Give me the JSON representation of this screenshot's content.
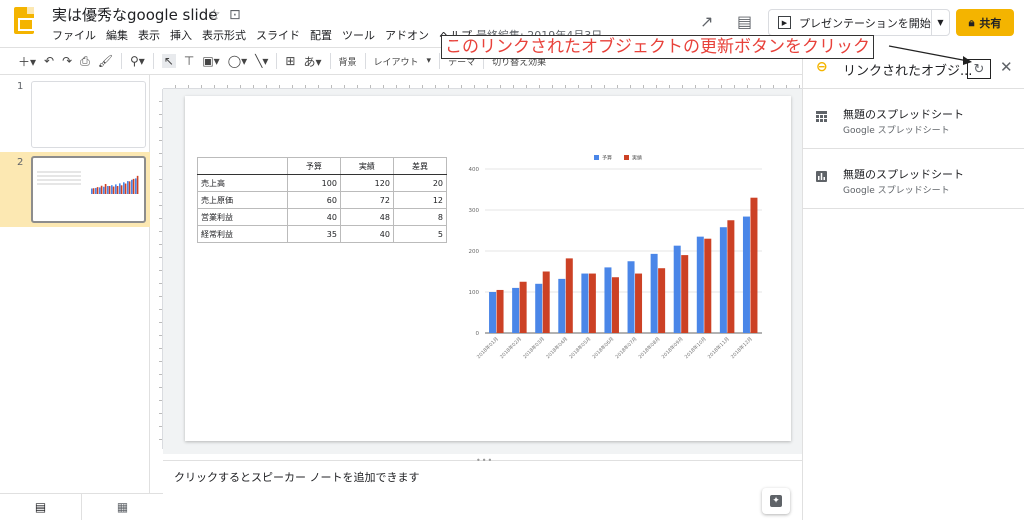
{
  "header": {
    "title": "実は優秀なgoogle slide",
    "menu": [
      "ファイル",
      "編集",
      "表示",
      "挿入",
      "表示形式",
      "スライド",
      "配置",
      "ツール",
      "アドオン",
      "ヘルプ"
    ],
    "last_edit": "最終編集: 2019年4月3日",
    "present_label": "プレゼンテーションを開始",
    "share_label": "共有"
  },
  "toolbar": {
    "background_label": "背景",
    "layout_label": "レイアウト",
    "theme_label": "テーマ",
    "transition_label": "切り替え効果"
  },
  "annotation": {
    "text": "このリンクされたオブジェクトの更新ボタンをクリック"
  },
  "filmstrip": {
    "slides": [
      "1",
      "2"
    ]
  },
  "slide": {
    "table": {
      "headers": [
        "",
        "予算",
        "実績",
        "差異"
      ],
      "rows": [
        {
          "label": "売上高",
          "budget": "100",
          "actual": "120",
          "diff": "20"
        },
        {
          "label": "売上原価",
          "budget": "60",
          "actual": "72",
          "diff": "12"
        },
        {
          "label": "営業利益",
          "budget": "40",
          "actual": "48",
          "diff": "8"
        },
        {
          "label": "経常利益",
          "budget": "35",
          "actual": "40",
          "diff": "5"
        }
      ]
    }
  },
  "chart_data": {
    "type": "bar",
    "categories": [
      "2018年01月",
      "2018年02月",
      "2018年03月",
      "2018年04月",
      "2018年05月",
      "2018年06月",
      "2018年07月",
      "2018年08月",
      "2018年09月",
      "2018年10月",
      "2018年11月",
      "2018年12月"
    ],
    "series": [
      {
        "name": "予算",
        "color": "#4a86e8",
        "values": [
          100,
          110,
          120,
          132,
          145,
          160,
          175,
          193,
          213,
          235,
          258,
          284
        ]
      },
      {
        "name": "実績",
        "color": "#cc4125",
        "values": [
          105,
          125,
          150,
          182,
          145,
          136,
          145,
          158,
          190,
          230,
          275,
          330
        ]
      }
    ],
    "yticks": [
      "0",
      "100",
      "200",
      "300",
      "400"
    ],
    "ylim": [
      0,
      400
    ],
    "legend_position": "top"
  },
  "notes": {
    "placeholder": "クリックするとスピーカー ノートを追加できます"
  },
  "side_panel": {
    "title": "リンクされたオブジ...",
    "items": [
      {
        "name": "無題のスプレッドシート",
        "source": "Google スプレッドシート",
        "icon": "table-icon"
      },
      {
        "name": "無題のスプレッドシート",
        "source": "Google スプレッドシート",
        "icon": "chart-icon"
      }
    ]
  }
}
